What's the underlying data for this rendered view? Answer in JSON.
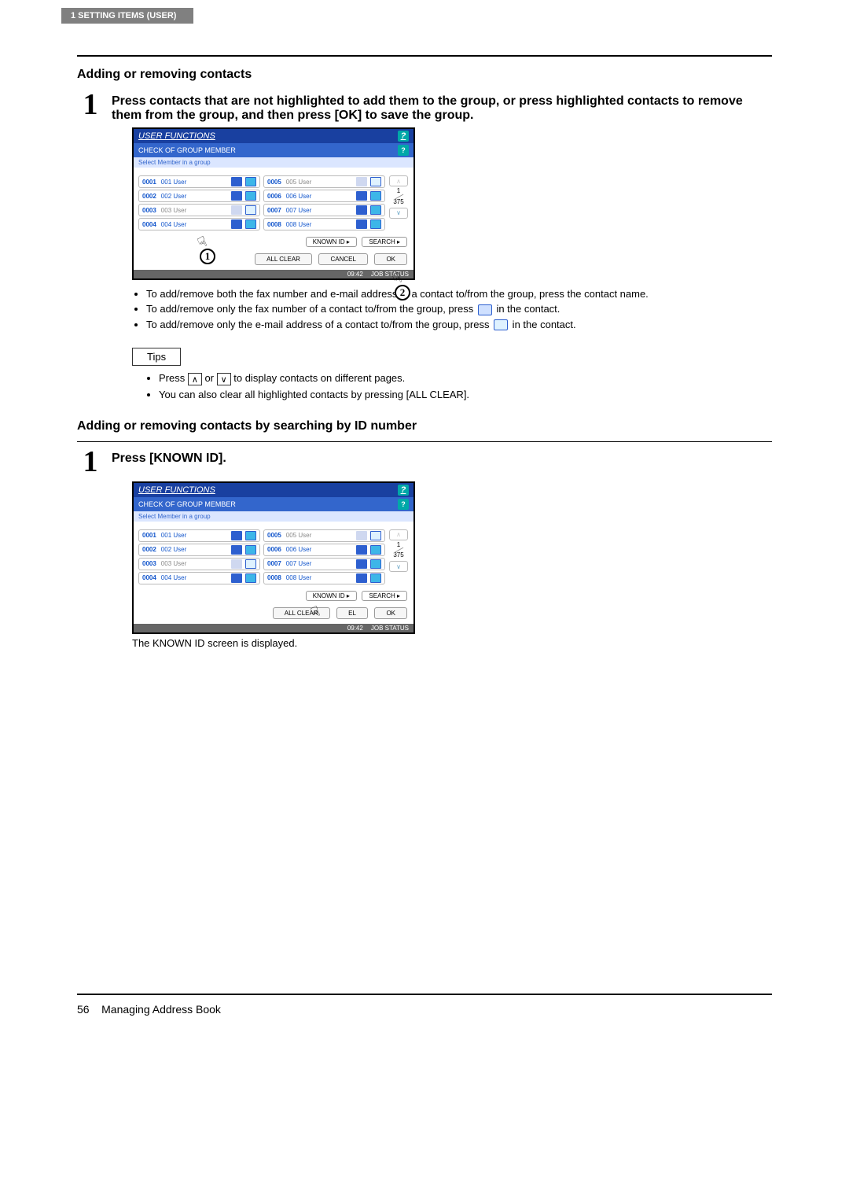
{
  "header_tab": "1 SETTING ITEMS (USER)",
  "section1": {
    "title": "Adding or removing contacts",
    "step1_text": "Press contacts that are not highlighted to add them to the group, or press highlighted contacts to remove them from the group, and then press [OK] to save the group.",
    "note1": "To add/remove both the fax number and e-mail address of a contact to/from the group, press the contact name.",
    "note2a": "To add/remove only the fax number of a contact to/from the group, press ",
    "note2b": " in the contact.",
    "note3a": "To add/remove only the e-mail address of a contact to/from the group, press ",
    "note3b": " in the contact.",
    "tips_label": "Tips",
    "tip1a": "Press ",
    "tip1b": " or ",
    "tip1c": " to display contacts on different pages.",
    "tip2": "You can also clear all highlighted contacts by pressing [ALL CLEAR]."
  },
  "section2": {
    "title": "Adding or removing contacts by searching by ID number",
    "step1_text": "Press [KNOWN ID].",
    "result_text": "The KNOWN ID screen is displayed."
  },
  "screen": {
    "title": "USER FUNCTIONS",
    "sub": "CHECK OF GROUP MEMBER",
    "hint": "Select Member in a group",
    "contacts_left": [
      {
        "id": "0001",
        "name": "001 User",
        "sel": true
      },
      {
        "id": "0002",
        "name": "002 User",
        "sel": true
      },
      {
        "id": "0003",
        "name": "003 User",
        "sel": false
      },
      {
        "id": "0004",
        "name": "004 User",
        "sel": true
      }
    ],
    "contacts_right": [
      {
        "id": "0005",
        "name": "005 User",
        "sel": false
      },
      {
        "id": "0006",
        "name": "006 User",
        "sel": true
      },
      {
        "id": "0007",
        "name": "007 User",
        "sel": true
      },
      {
        "id": "0008",
        "name": "008 User",
        "sel": true
      }
    ],
    "page_current": "1",
    "page_total": "375",
    "known_id": "KNOWN ID",
    "search": "SEARCH",
    "all_clear": "ALL CLEAR",
    "cancel": "CANCEL",
    "ok": "OK",
    "time": "09:42",
    "job_status": "JOB STATUS"
  },
  "footer": {
    "page_num": "56",
    "section": "Managing Address Book"
  }
}
